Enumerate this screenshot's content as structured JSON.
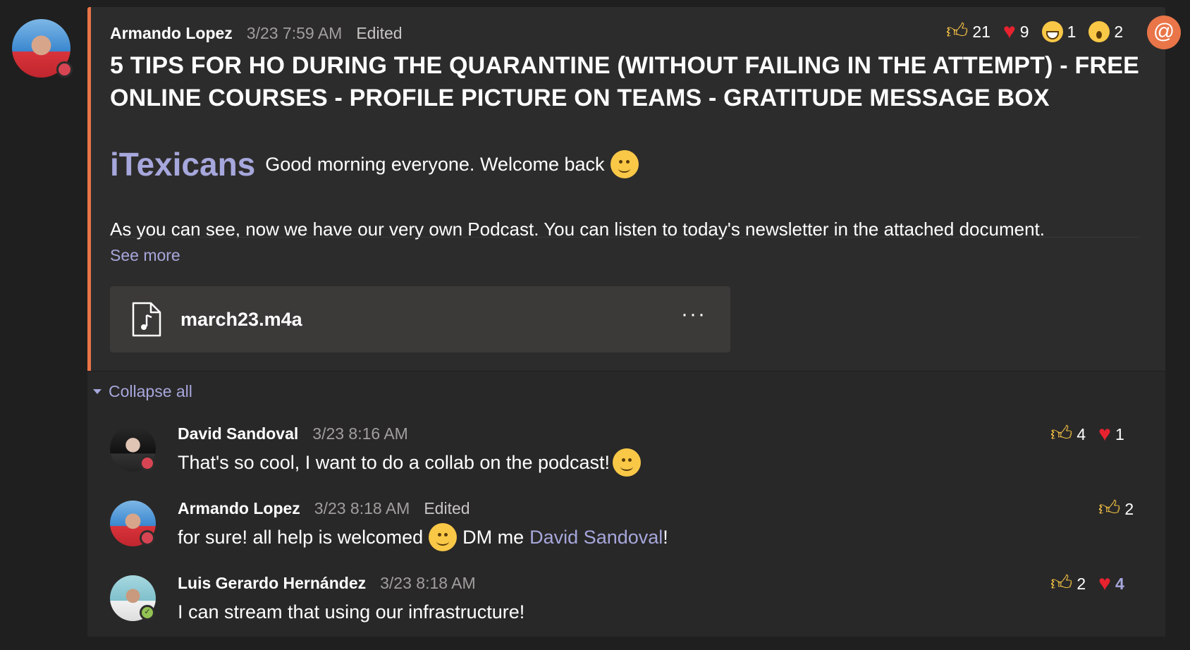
{
  "post": {
    "author": "Armando Lopez",
    "timestamp": "3/23 7:59 AM",
    "edited": "Edited",
    "title": "5 TIPS FOR HO DURING THE QUARANTINE (WITHOUT FAILING IN THE ATTEMPT) - FREE ONLINE COURSES - PROFILE PICTURE ON TEAMS - GRATITUDE MESSAGE BOX",
    "brand": "iTexicans",
    "greeting": "Good morning everyone. Welcome back",
    "body": "As you can see, now we have our very own Podcast. You can listen to today's newsletter in the attached document.",
    "see_more": "See more",
    "attachment": {
      "name": "march23.m4a",
      "icon": "audio-file-icon",
      "more": "···"
    },
    "reactions": [
      {
        "icon": "like-icon",
        "count": "21"
      },
      {
        "icon": "heart-icon",
        "count": "9"
      },
      {
        "icon": "laugh-icon",
        "count": "1"
      },
      {
        "icon": "surprised-icon",
        "count": "2"
      }
    ],
    "mention_badge": "@"
  },
  "collapse_all": "Collapse all",
  "replies": [
    {
      "author": "David Sandoval",
      "timestamp": "3/23 8:16 AM",
      "text": "That's so cool, I want to do a collab on the podcast!",
      "reactions": [
        {
          "icon": "like-icon",
          "count": "4"
        },
        {
          "icon": "heart-icon",
          "count": "1"
        }
      ]
    },
    {
      "author": "Armando Lopez",
      "timestamp": "3/23 8:18 AM",
      "edited": "Edited",
      "text_before": "for sure! all help is welcomed",
      "text_middle": "DM me",
      "mention": "David Sandoval",
      "text_after": "!",
      "reactions": [
        {
          "icon": "like-icon",
          "count": "2"
        }
      ]
    },
    {
      "author": "Luis Gerardo Hernández",
      "timestamp": "3/23 8:18 AM",
      "text": "I can stream that using our infrastructure!",
      "reactions": [
        {
          "icon": "like-icon",
          "count": "2"
        },
        {
          "icon": "heart-icon",
          "count": "4"
        }
      ]
    }
  ],
  "colors": {
    "accent": "#e97548",
    "mention": "#a6a7dc",
    "background": "#1f1f1f",
    "card": "#2d2c2c"
  }
}
